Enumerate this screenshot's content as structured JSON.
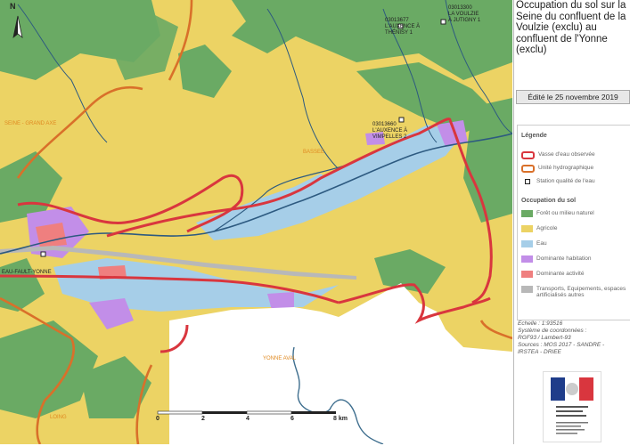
{
  "title": "Occupation du sol sur la Seine du confluent de la Voulzie (exclu) au confluent de l'Yonne (exclu)",
  "edited": "Édité le 25 novembre 2019",
  "north_label": "N",
  "legend": {
    "heading": "Légende",
    "items": [
      {
        "label": "Vasse d'eau observée",
        "kind": "line",
        "color": "#d9363e"
      },
      {
        "label": "Unité hydrographique",
        "kind": "line",
        "color": "#d9702a"
      },
      {
        "label": "Station qualité de l'eau",
        "kind": "square",
        "color": "#222222"
      }
    ],
    "landuse_heading": "Occupation du sol",
    "landuse": [
      {
        "label": "Forêt ou milieu naturel",
        "color": "#6aaa64"
      },
      {
        "label": "Agricole",
        "color": "#ecd364"
      },
      {
        "label": "Eau",
        "color": "#a6cee8"
      },
      {
        "label": "Dominante habitation",
        "color": "#c28ee8"
      },
      {
        "label": "Dominante activité",
        "color": "#ef7f7f"
      },
      {
        "label": "Transports, Equipements, espaces artificialisés autres",
        "color": "#b8b8b8"
      }
    ]
  },
  "scale_text": "Echelle : 1:93516",
  "meta": [
    "Système de coordonnées :",
    "RGF93 / Lambert-93",
    "Sources : MOS 2017 - SANDRE -",
    "IRSTEA - DRIEE"
  ],
  "scalebar": {
    "labels": [
      "0",
      "2",
      "4",
      "6",
      "8 km"
    ]
  },
  "stations": [
    {
      "code": "03013300",
      "name": "LA VOULZIE À JUTIGNY 1"
    },
    {
      "code": "03013677",
      "name": "L'AUXENCE À THÉNISY 1"
    },
    {
      "code": "03013660",
      "name": "L'AUXENCE À VIMPELLES 2"
    },
    {
      "code": "",
      "name": "EAU-FAULT-YONNE"
    }
  ],
  "watercourses": [
    "SEINE - GRAND AXE",
    "YONNE AVAL",
    "LOING",
    "BASSEE"
  ]
}
